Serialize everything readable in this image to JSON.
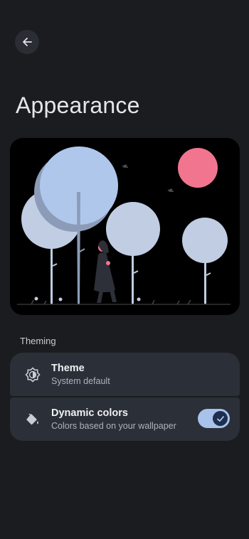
{
  "header": {
    "title": "Appearance",
    "back_icon": "arrow-back-icon"
  },
  "section": {
    "label": "Theming"
  },
  "settings": [
    {
      "icon": "theme-brightness-icon",
      "title": "Theme",
      "subtitle": "System default"
    },
    {
      "icon": "paint-bucket-icon",
      "title": "Dynamic colors",
      "subtitle": "Colors based on your wallpaper",
      "toggle_on": true
    }
  ],
  "colors": {
    "accent": "#a9c2ec",
    "card": "#2b2f37",
    "background": "#1a1c1f"
  }
}
